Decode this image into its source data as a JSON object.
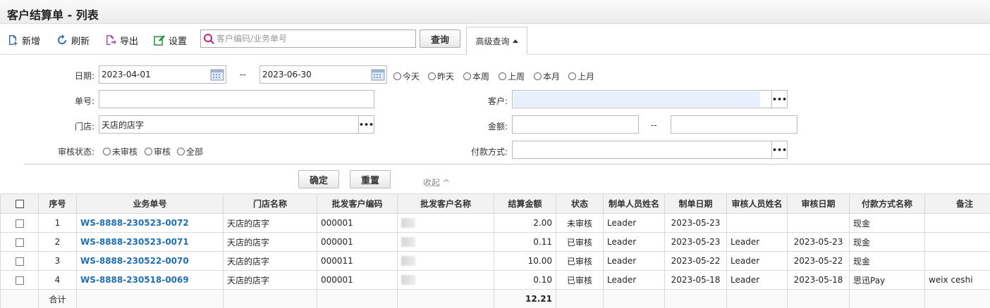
{
  "page": {
    "title": "客户结算单 - 列表"
  },
  "toolbar": {
    "add_label": "新增",
    "refresh_label": "刷新",
    "export_label": "导出",
    "settings_label": "设置",
    "search_placeholder": "客户编码/业务单号",
    "query_label": "查询",
    "advanced_label": "高级查询"
  },
  "filters": {
    "date_label": "日期:",
    "date_from": "2023-04-01",
    "date_sep": "--",
    "date_to": "2023-06-30",
    "quick_ranges": [
      "今天",
      "昨天",
      "本周",
      "上周",
      "本月",
      "上月"
    ],
    "order_no_label": "单号:",
    "order_no_value": "",
    "customer_label": "客户:",
    "customer_value": "",
    "store_label": "门店:",
    "store_value": "天店的店字",
    "amount_label": "金额:",
    "amount_from": "",
    "amount_sep": "--",
    "amount_to": "",
    "audit_label": "审核状态:",
    "audit_options": [
      "未审核",
      "审核",
      "全部"
    ],
    "payment_label": "付款方式:",
    "payment_value": "",
    "confirm_label": "确定",
    "reset_label": "重置",
    "collapse_label": "收起 ^"
  },
  "colors": {
    "link": "#1f6fb2",
    "header_bg": "#f2f2f2",
    "search_icon": "#c0267a"
  },
  "table": {
    "headers": [
      "序号",
      "业务单号",
      "门店名称",
      "批发客户编码",
      "批发客户名称",
      "结算金额",
      "状态",
      "制单人员姓名",
      "制单日期",
      "审核人员姓名",
      "审核日期",
      "付款方式名称",
      "备注"
    ],
    "rows": [
      {
        "no": "1",
        "order": "WS-8888-230523-0072",
        "store": "天店的店字",
        "code": "000001",
        "amount": "2.00",
        "status": "未审核",
        "maker": "Leader",
        "make_date": "2023-05-23",
        "auditor": "",
        "audit_date": "",
        "pay": "现金",
        "remark": ""
      },
      {
        "no": "2",
        "order": "WS-8888-230523-0071",
        "store": "天店的店字",
        "code": "000001",
        "amount": "0.11",
        "status": "已审核",
        "maker": "Leader",
        "make_date": "2023-05-23",
        "auditor": "Leader",
        "audit_date": "2023-05-23",
        "pay": "现金",
        "remark": ""
      },
      {
        "no": "3",
        "order": "WS-8888-230522-0070",
        "store": "天店的店字",
        "code": "000011",
        "amount": "10.00",
        "status": "已审核",
        "maker": "Leader",
        "make_date": "2023-05-22",
        "auditor": "Leader",
        "audit_date": "2023-05-22",
        "pay": "现金",
        "remark": ""
      },
      {
        "no": "4",
        "order": "WS-8888-230518-0069",
        "store": "天店的店字",
        "code": "000001",
        "amount": "0.10",
        "status": "已审核",
        "maker": "Leader",
        "make_date": "2023-05-18",
        "auditor": "Leader",
        "audit_date": "2023-05-18",
        "pay": "思迅Pay",
        "remark": "weix ceshi"
      }
    ],
    "total_label": "合计",
    "total_amount": "12.21"
  }
}
